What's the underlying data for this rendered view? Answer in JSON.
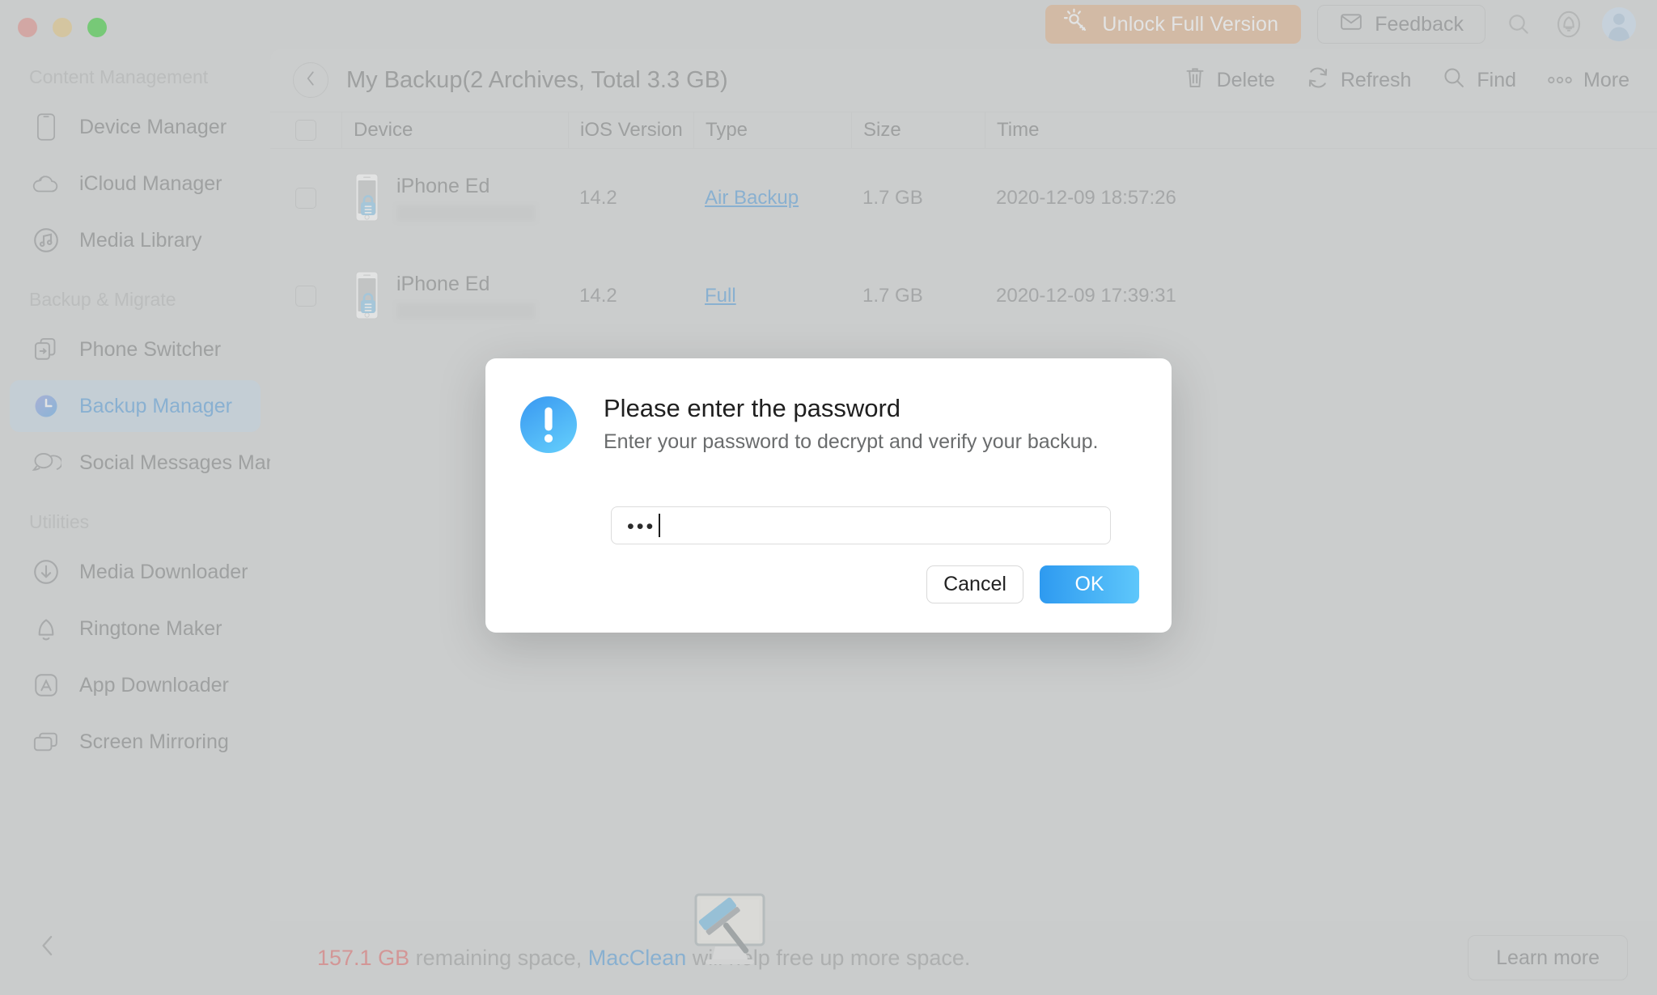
{
  "window": {
    "traffic_lights": [
      "close",
      "minimize",
      "zoom"
    ],
    "colors": {
      "close": "#dd7b75",
      "minimize": "#e2bd6c",
      "zoom": "#13c712",
      "accent_blue": "#3b8fd6",
      "unlock_orange": "#dda678",
      "warning_red": "#e05757",
      "sidebar_active_bg": "#bdd2e2"
    }
  },
  "topbar": {
    "unlock_label": "Unlock Full Version",
    "unlock_icon": "key-sparkle-icon",
    "feedback_label": "Feedback",
    "feedback_icon": "envelope-icon",
    "search_icon": "search-icon",
    "notification_icon": "bell-icon",
    "avatar_icon": "user-avatar-icon"
  },
  "sidebar": {
    "sections": [
      {
        "title": "Content Management",
        "items": [
          {
            "label": "Device Manager",
            "icon": "phone-outline-icon",
            "active": false
          },
          {
            "label": "iCloud Manager",
            "icon": "cloud-icon",
            "active": false
          },
          {
            "label": "Media Library",
            "icon": "music-note-circle-icon",
            "active": false
          }
        ]
      },
      {
        "title": "Backup & Migrate",
        "items": [
          {
            "label": "Phone Switcher",
            "icon": "transfer-arrow-icon",
            "active": false
          },
          {
            "label": "Backup Manager",
            "icon": "clock-icon",
            "active": true
          },
          {
            "label": "Social Messages Manager",
            "icon": "chat-bubbles-icon",
            "active": false
          }
        ]
      },
      {
        "title": "Utilities",
        "items": [
          {
            "label": "Media Downloader",
            "icon": "download-circle-icon",
            "active": false
          },
          {
            "label": "Ringtone Maker",
            "icon": "bell-outline-icon",
            "active": false
          },
          {
            "label": "App Downloader",
            "icon": "app-store-icon",
            "active": false
          },
          {
            "label": "Screen Mirroring",
            "icon": "screens-stack-icon",
            "active": false
          }
        ]
      }
    ],
    "collapse_icon": "chevron-left-icon"
  },
  "main": {
    "back_icon": "chevron-left-icon",
    "title": "My Backup(2 Archives, Total  3.3 GB)",
    "actions": [
      {
        "label": "Delete",
        "icon": "trash-icon"
      },
      {
        "label": "Refresh",
        "icon": "refresh-icon"
      },
      {
        "label": "Find",
        "icon": "search-icon"
      },
      {
        "label": "More",
        "icon": "ellipsis-icon"
      }
    ],
    "table": {
      "columns": [
        "Device",
        "iOS Version",
        "Type",
        "Size",
        "Time"
      ],
      "rows": [
        {
          "device_name": "iPhone Ed",
          "device_sub": "",
          "device_icon": "iphone-locked-icon",
          "ios_version": "14.2",
          "type": "Air Backup",
          "size": "1.7 GB",
          "time": "2020-12-09 18:57:26",
          "checked": false
        },
        {
          "device_name": "iPhone Ed",
          "device_sub": "",
          "device_icon": "iphone-locked-icon",
          "ios_version": "14.2",
          "type": "Full",
          "size": "1.7 GB",
          "time": "2020-12-09 17:39:31",
          "checked": false
        }
      ]
    }
  },
  "statusbar": {
    "illustration_icon": "imac-squeegee-icon",
    "size_value": "157.1 GB",
    "text_middle": " remaining space, ",
    "brand": "MacClean",
    "text_end": " will help free up more space.",
    "learn_more_label": "Learn more"
  },
  "modal": {
    "alert_icon": "exclamation-circle-icon",
    "title": "Please enter the password",
    "message": "Enter your password to decrypt and verify your backup.",
    "password_value": "•••",
    "password_placeholder": "",
    "cancel_label": "Cancel",
    "ok_label": "OK"
  }
}
